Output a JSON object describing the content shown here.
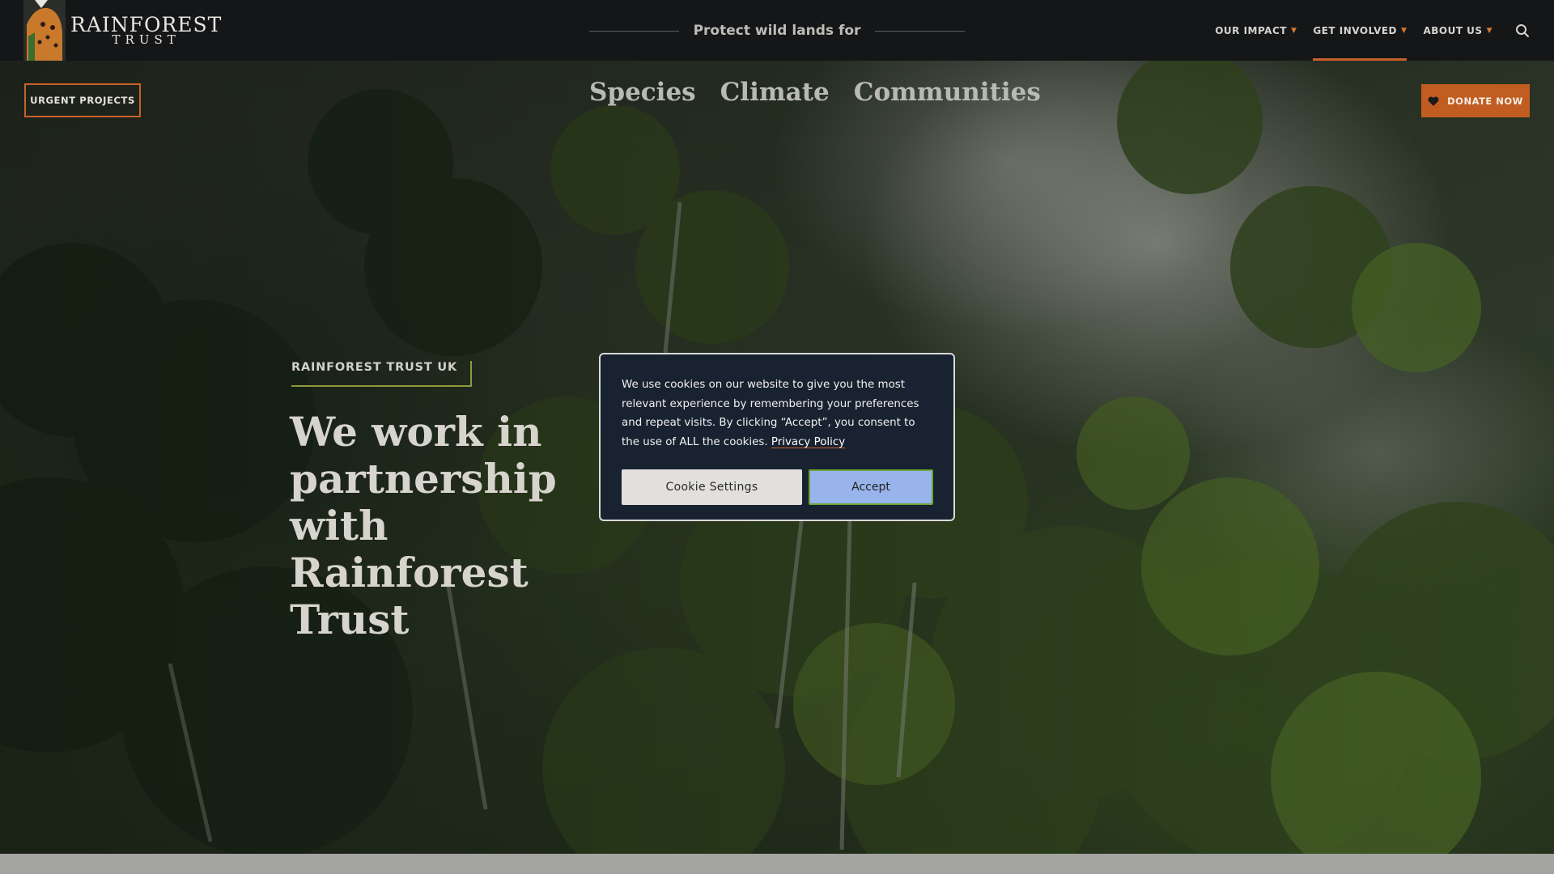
{
  "brand": {
    "name_line1": "RAINFOREST",
    "name_line2": "TRUST",
    "logo_icon": "jaguar-icon"
  },
  "header": {
    "tagline": "Protect wild lands for",
    "nav": [
      {
        "label": "OUR IMPACT",
        "active": false
      },
      {
        "label": "GET INVOLVED",
        "active": true
      },
      {
        "label": "ABOUT US",
        "active": false
      }
    ],
    "search_icon": "search-icon"
  },
  "subbar": {
    "urgent_label": "URGENT PROJECTS",
    "pillars": [
      "Species",
      "Climate",
      "Communities"
    ],
    "donate_label": "DONATE NOW",
    "donate_icon": "heart-icon"
  },
  "hero": {
    "eyebrow": "RAINFOREST TRUST UK",
    "title": "We work in\npartnership with\nRainforest Trust"
  },
  "cookie": {
    "message": "We use cookies on our website to give you the most relevant experience by remembering your preferences and repeat visits. By clicking “Accept”, you consent to the use of ALL the cookies. ",
    "link_label": "Privacy Policy",
    "settings_label": "Cookie Settings",
    "accept_label": "Accept"
  },
  "colors": {
    "header_bg": "#141617",
    "accent_orange": "#c9602a",
    "accent_green": "#8e9a3a",
    "modal_bg": "#192230",
    "accept_bg": "#98b4ea"
  }
}
